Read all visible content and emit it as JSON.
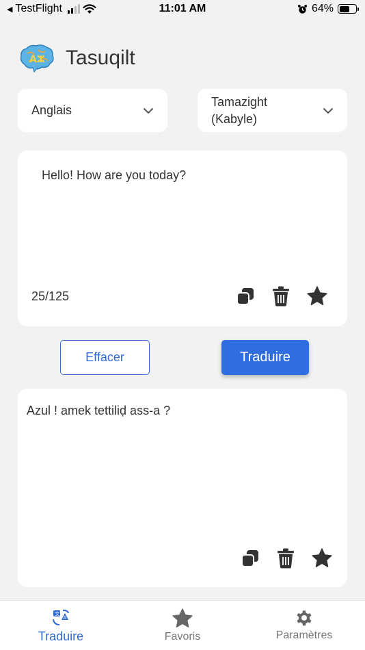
{
  "status_bar": {
    "back_app": "TestFlight",
    "time": "11:01 AM",
    "battery": "64%",
    "battery_level": 0.64
  },
  "header": {
    "title": "Tasuqilt",
    "logo_letters": "Aⵣ"
  },
  "languages": {
    "source": "Anglais",
    "target_line1": "Tamazight",
    "target_line2": "(Kabyle)"
  },
  "input": {
    "text": "Hello! How are you today?",
    "counter": "25/125"
  },
  "actions": {
    "clear": "Effacer",
    "translate": "Traduire"
  },
  "output": {
    "text": "Azul ! amek tettiliḍ ass-a ?"
  },
  "tabs": [
    {
      "label": "Traduire",
      "icon": "translate-icon",
      "active": true
    },
    {
      "label": "Favoris",
      "icon": "star-icon",
      "active": false
    },
    {
      "label": "Paramètres",
      "icon": "gear-icon",
      "active": false
    }
  ],
  "colors": {
    "accent": "#2f6ee0",
    "background": "#f2f2f2",
    "card": "#ffffff",
    "icon": "#333333"
  }
}
